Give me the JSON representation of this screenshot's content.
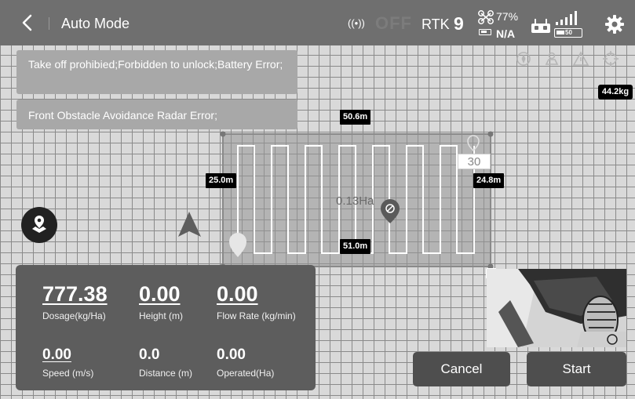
{
  "header": {
    "title": "Auto Mode",
    "radar_status": "OFF",
    "rtk_label": "RTK",
    "rtk_count": "9",
    "drone_battery": "77%",
    "drone_voltage": "N/A",
    "rc_battery": "50"
  },
  "alerts": [
    "Take off prohibied;Forbidden to unlock;Battery Error;",
    "Front Obstacle Avoidance Radar Error;"
  ],
  "tools": [
    "compass-icon",
    "field-edit-icon",
    "obstacle-warning-icon",
    "target-icon"
  ],
  "payload": "44.2kg",
  "field": {
    "top_edge": "50.6m",
    "bottom_edge": "51.0m",
    "left_edge": "25.0m",
    "right_edge": "24.8m",
    "line_spacing": "30",
    "area": "0.13Ha"
  },
  "stats": {
    "dosage": {
      "value": "777.38",
      "label": "Dosage(kg/Ha)"
    },
    "height": {
      "value": "0.00",
      "label": "Height (m)"
    },
    "flow_rate": {
      "value": "0.00",
      "label": "Flow Rate (kg/min)"
    },
    "speed": {
      "value": "0.00",
      "label": "Speed (m/s)"
    },
    "distance": {
      "value": "0.0",
      "label": "Distance (m)"
    },
    "operated": {
      "value": "0.00",
      "label": "Operated(Ha)"
    }
  },
  "buttons": {
    "cancel": "Cancel",
    "start": "Start"
  }
}
